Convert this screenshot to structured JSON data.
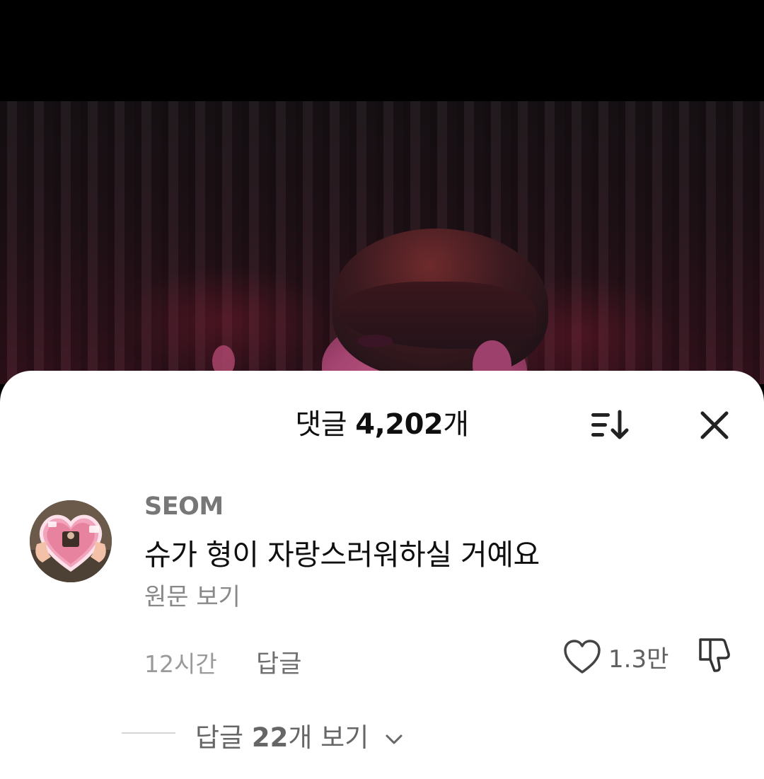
{
  "video": {
    "scene": "stage-curtain-performer"
  },
  "comments_sheet": {
    "title_prefix": "댓글",
    "title_count": "4,202",
    "title_suffix": "개",
    "icons": {
      "sort": "sort-icon",
      "close": "close-icon"
    }
  },
  "comment": {
    "author": "SEOM",
    "text": "슈가 형이 자랑스러워하실 거예요",
    "translate_label": "원문 보기",
    "time": "12시간",
    "reply_label": "답글",
    "like_count": "1.3만",
    "icons": {
      "avatar": "avatar",
      "like": "heart-icon",
      "dislike": "thumbs-down-icon"
    }
  },
  "replies": {
    "prefix": "답글",
    "count": "22",
    "suffix": "개 보기",
    "icon": "chevron-down-icon"
  }
}
